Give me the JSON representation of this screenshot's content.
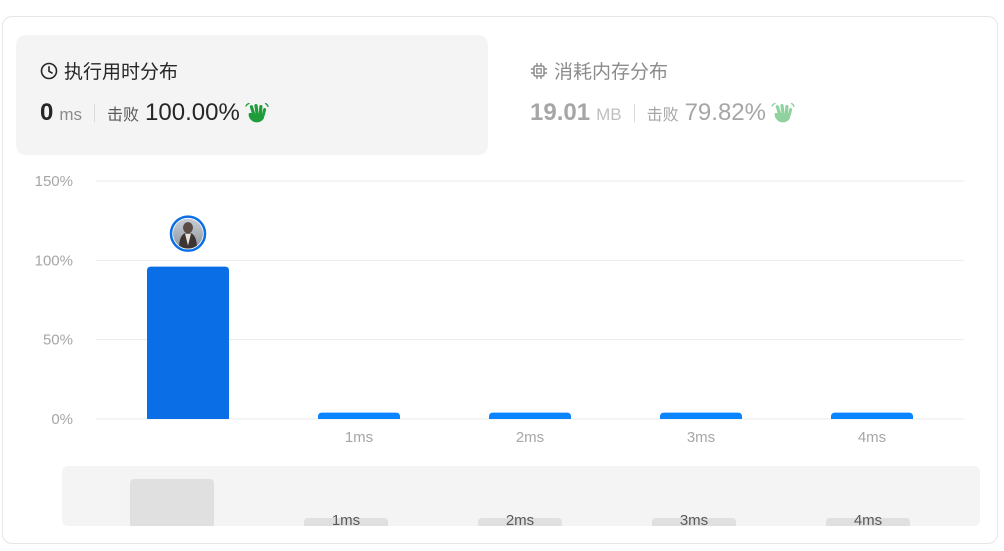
{
  "runtime": {
    "title": "执行用时分布",
    "value": "0",
    "unit": "ms",
    "beats_label": "击败",
    "percent": "100.00%"
  },
  "memory": {
    "title": "消耗内存分布",
    "value": "19.01",
    "unit": "MB",
    "beats_label": "击败",
    "percent": "79.82%"
  },
  "colors": {
    "bar": "#0a6ee6",
    "bar_light": "#0a84ff",
    "hand_active": "#1f9d3a",
    "hand_inactive": "#8fd29f"
  },
  "chart_data": {
    "type": "bar",
    "categories": [
      "",
      "1ms",
      "2ms",
      "3ms",
      "4ms"
    ],
    "values": [
      96,
      4,
      4,
      4,
      4
    ],
    "ylim": [
      0,
      150
    ],
    "yticks": [
      "0%",
      "50%",
      "100%",
      "150%"
    ],
    "ytick_values": [
      0,
      50,
      100,
      150
    ],
    "highlight_index": 0,
    "grid": true,
    "overview": {
      "categories": [
        "",
        "1ms",
        "2ms",
        "3ms",
        "4ms"
      ]
    }
  }
}
